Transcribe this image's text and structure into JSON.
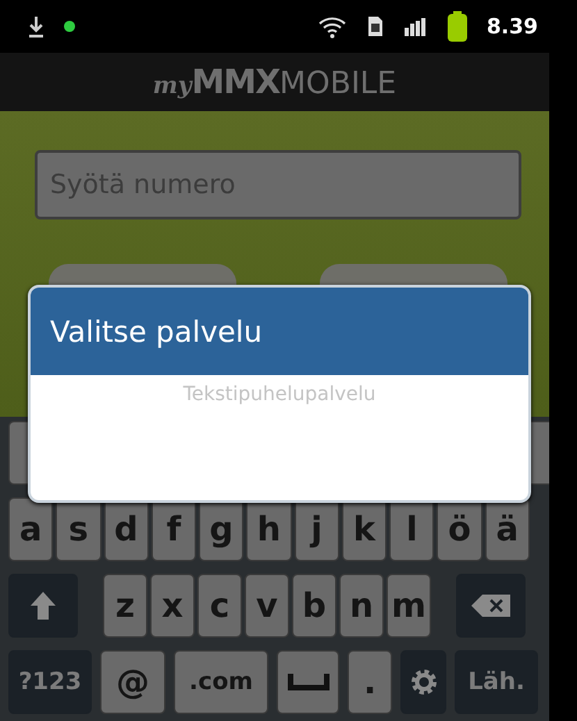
{
  "status_bar": {
    "time": "8.39"
  },
  "header": {
    "logo": [
      "my",
      "MMX",
      "MOBILE"
    ]
  },
  "number_field": {
    "placeholder": "Syötä numero"
  },
  "dialog": {
    "title": "Valitse palvelu",
    "items": [
      {
        "label": "Tekstipuhelupalvelu",
        "disabled": true
      }
    ]
  },
  "keyboard": {
    "middle_row": [
      {
        "kind": "letter",
        "label": "a"
      },
      {
        "kind": "letter",
        "label": "s"
      },
      {
        "kind": "letter",
        "label": "d"
      },
      {
        "kind": "letter",
        "label": "f"
      },
      {
        "kind": "letter",
        "label": "g"
      },
      {
        "kind": "letter",
        "label": "h"
      },
      {
        "kind": "letter",
        "label": "j"
      },
      {
        "kind": "letter",
        "label": "k"
      },
      {
        "kind": "letter",
        "label": "l"
      },
      {
        "kind": "letter",
        "label": "ö"
      },
      {
        "kind": "letter",
        "label": "ä"
      }
    ],
    "lower_row": [
      {
        "kind": "shift"
      },
      {
        "kind": "letter",
        "label": "z"
      },
      {
        "kind": "letter",
        "label": "x"
      },
      {
        "kind": "letter",
        "label": "c"
      },
      {
        "kind": "letter",
        "label": "v"
      },
      {
        "kind": "letter",
        "label": "b"
      },
      {
        "kind": "letter",
        "label": "n"
      },
      {
        "kind": "letter",
        "label": "m"
      },
      {
        "kind": "backspace"
      }
    ],
    "bottom_row": [
      {
        "kind": "function",
        "label": "?123"
      },
      {
        "kind": "letter",
        "label": "@"
      },
      {
        "kind": "letter",
        "label": ".com"
      },
      {
        "kind": "space"
      },
      {
        "kind": "letter",
        "label": "."
      },
      {
        "kind": "settings"
      },
      {
        "kind": "function",
        "label": "Läh."
      }
    ]
  }
}
